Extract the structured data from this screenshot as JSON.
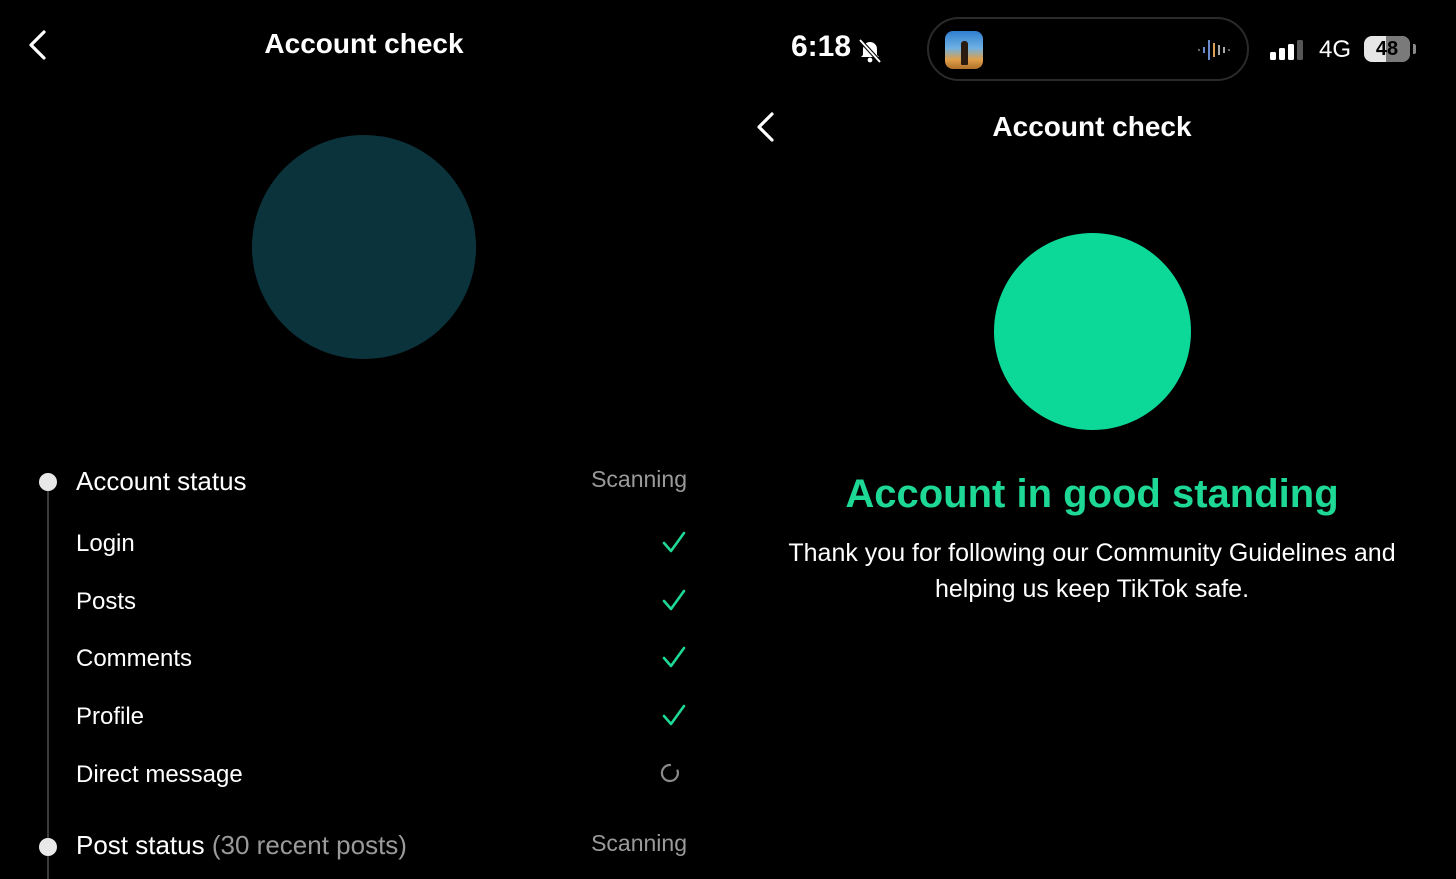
{
  "left": {
    "header": {
      "title": "Account check",
      "back_icon": "chevron-left-icon"
    },
    "account_section": {
      "title": "Account status",
      "status": "Scanning",
      "items": [
        {
          "label": "Login",
          "state": "done",
          "icon": "checkmark-icon"
        },
        {
          "label": "Posts",
          "state": "done",
          "icon": "checkmark-icon"
        },
        {
          "label": "Comments",
          "state": "done",
          "icon": "checkmark-icon"
        },
        {
          "label": "Profile",
          "state": "done",
          "icon": "checkmark-icon"
        },
        {
          "label": "Direct message",
          "state": "loading",
          "icon": "loading-spinner-icon"
        }
      ]
    },
    "post_section": {
      "title": "Post status",
      "subtitle": "(30 recent posts)",
      "status": "Scanning"
    }
  },
  "right": {
    "status_bar": {
      "time": "6:18",
      "silent_icon": "bell-slash-icon",
      "network": "4G",
      "battery": "48",
      "battery_level_pct": 48
    },
    "header": {
      "title": "Account check",
      "back_icon": "chevron-left-icon"
    },
    "result": {
      "heading": "Account in good standing",
      "message": "Thank you for following our Community Guidelines and helping us keep TikTok safe."
    }
  },
  "colors": {
    "accent_green": "#1ed995",
    "circle_scanning": "#0b333c",
    "circle_success": "#0cd998",
    "muted_text": "#9a9a9a"
  }
}
